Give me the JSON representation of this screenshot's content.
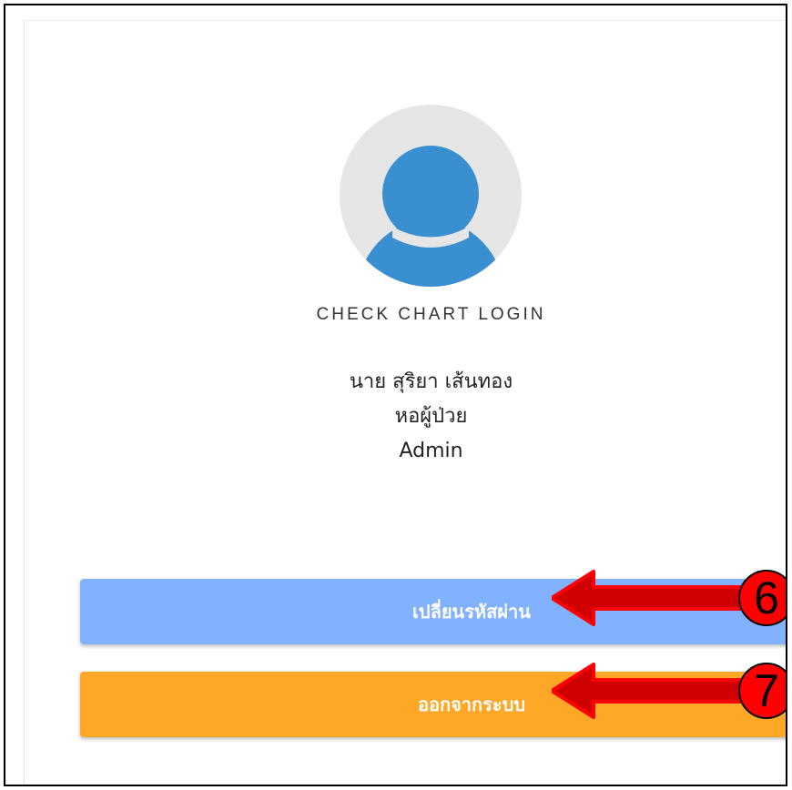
{
  "profile": {
    "app_title": "CHECK CHART LOGIN",
    "user_name": "นาย สุริยา เส้นทอง",
    "department": "หอผู้ป่วย",
    "role": "Admin"
  },
  "actions": {
    "change_password_label": "เปลี่ยนรหัสผ่าน",
    "logout_label": "ออกจากระบบ"
  },
  "annotations": {
    "change_password_callout": "6",
    "logout_callout": "7"
  },
  "colors": {
    "avatar_background": "#e6e6e6",
    "avatar_figure": "#3a8fd0",
    "change_password_button": "#82b1ff",
    "logout_button": "#ffa726",
    "annotation_red": "#ff0000",
    "annotation_arrow_fill": "#d00000"
  }
}
